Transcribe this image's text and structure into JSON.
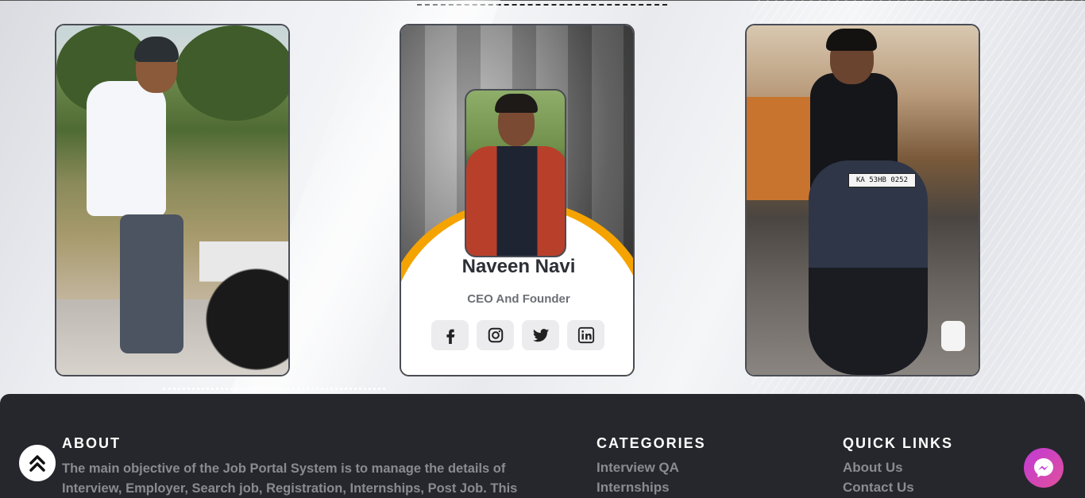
{
  "team": {
    "left_photo_alt": "",
    "right_photo_alt": "",
    "featured": {
      "name": "Naveen Navi",
      "role": "CEO And Founder",
      "socials": [
        {
          "icon": "facebook-icon"
        },
        {
          "icon": "instagram-icon"
        },
        {
          "icon": "twitter-icon"
        },
        {
          "icon": "linkedin-icon"
        }
      ]
    },
    "plate_text": "KA 53HB 0252"
  },
  "footer": {
    "about": {
      "title": "ABOUT",
      "text": "The main objective of the Job Portal System is to manage the details of Interview, Employer, Search job, Registration, Internships, Post Job. This"
    },
    "categories": {
      "title": "CATEGORIES",
      "links": [
        "Interview QA",
        "Internships"
      ]
    },
    "quick_links": {
      "title": "QUICK LINKS",
      "links": [
        "About Us",
        "Contact Us"
      ]
    }
  },
  "colors": {
    "accent_orange": "#f5a300",
    "footer_bg": "#26272c",
    "messenger": "#c13ad6"
  },
  "icons": {
    "scroll_top": "double-chevron-up-icon",
    "messenger": "messenger-icon"
  }
}
